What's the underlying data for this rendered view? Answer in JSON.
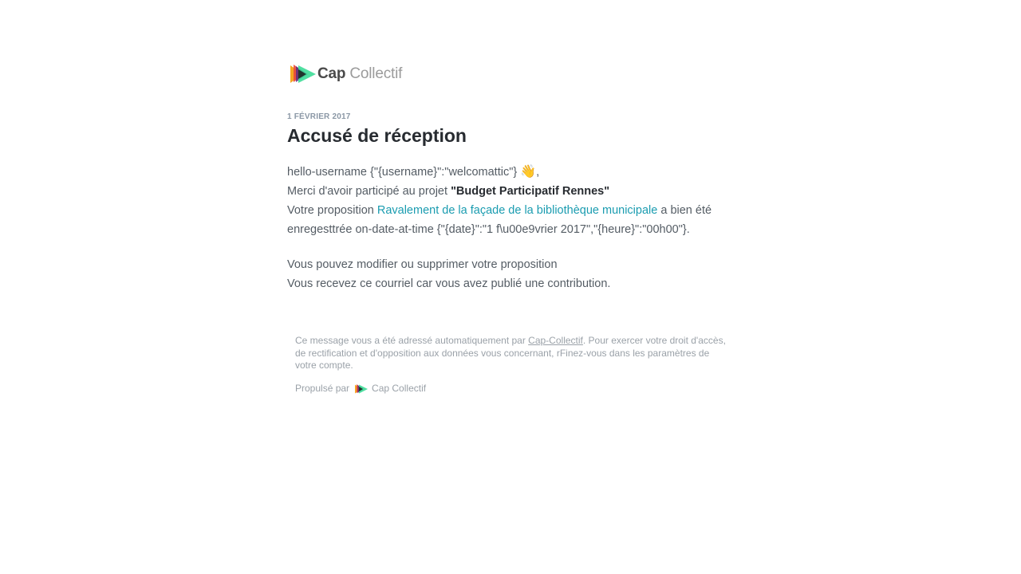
{
  "logo": {
    "brand_bold": "Cap",
    "brand_light": "Collectif"
  },
  "header": {
    "date": "1 février 2017",
    "title": "Accusé de réception"
  },
  "body": {
    "greeting": "hello-username {\"{username}\":\"welcomattic\"}",
    "wave_emoji": "👋",
    "greeting_suffix": ",",
    "participation_prefix": "Merci d'avoir participé au projet ",
    "project_name": "\"Budget Participatif Rennes\"",
    "proposal_prefix": "Votre proposition ",
    "proposal_link": "Ravalement de la façade de la bibliothèque municipale",
    "proposal_suffix": " a bien été enregesttrée on-date-at-time {\"{date}\":\"1 f\\u00e9vrier 2017\",\"{heure}\":\"00h00\"}.",
    "modify_text": "Vous pouvez modifier ou supprimer votre proposition",
    "reason_text": "Vous recevez ce courriel car vous avez publié une contribution."
  },
  "footer": {
    "notice_prefix": "Ce message vous a été adressé automatiquement par ",
    "notice_link": "Cap-Collectif",
    "notice_suffix": ". Pour exercer votre droit d'accès, de rectification et d'opposition aux données vous concernant, rFinez-vous dans les paramètres de votre compte.",
    "powered_by": "Propulsé par",
    "powered_brand": "Cap Collectif"
  },
  "colors": {
    "link": "#1a9cb0",
    "title": "#272b30",
    "body": "#545c64",
    "muted": "#9aa1a8",
    "date": "#8a97a5"
  }
}
